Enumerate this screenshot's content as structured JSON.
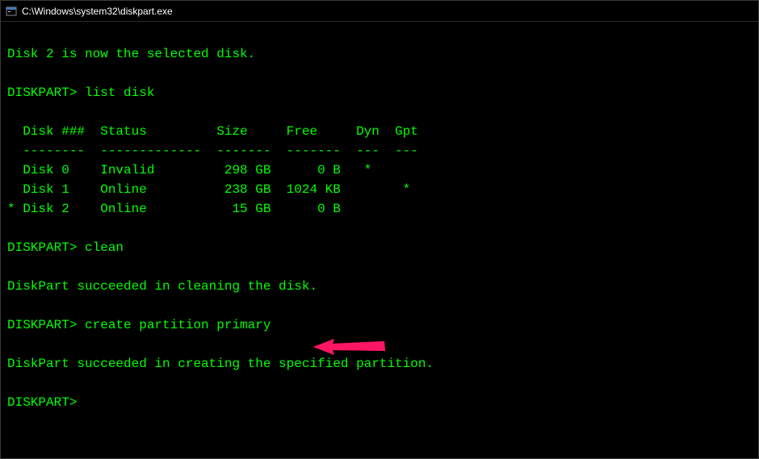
{
  "window": {
    "title": "C:\\Windows\\system32\\diskpart.exe"
  },
  "console": {
    "selected_msg": "Disk 2 is now the selected disk.",
    "prompt1": "DISKPART> list disk",
    "table": {
      "header": "  Disk ###  Status         Size     Free     Dyn  Gpt",
      "divider": "  --------  -------------  -------  -------  ---  ---",
      "row0": "  Disk 0    Invalid         298 GB      0 B   *",
      "row1": "  Disk 1    Online          238 GB  1024 KB        *",
      "row2": "* Disk 2    Online           15 GB      0 B"
    },
    "prompt2": "DISKPART> clean",
    "clean_msg": "DiskPart succeeded in cleaning the disk.",
    "prompt3": "DISKPART> create partition primary",
    "create_msg": "DiskPart succeeded in creating the specified partition.",
    "prompt4": "DISKPART>"
  },
  "annotation": {
    "arrow_color": "#ff1464"
  }
}
